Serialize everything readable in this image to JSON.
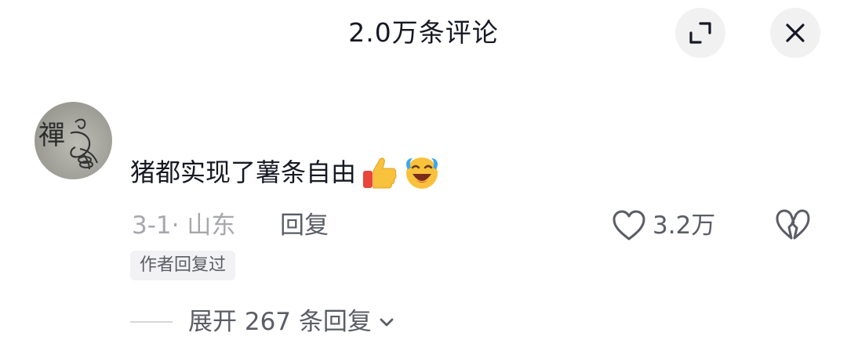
{
  "header": {
    "title": "2.0万条评论"
  },
  "comment": {
    "avatar_seal": "禪",
    "text": "猪都实现了薯条自由",
    "emojis": [
      "thumbs-up-emoji",
      "laughing-crying-emoji"
    ],
    "meta": "3-1· 山东",
    "reply_label": "回复",
    "like_count": "3.2万",
    "author_tag": "作者回复过",
    "expand_replies": "展开 267 条回复"
  },
  "icons": {
    "expand": "expand-icon",
    "close": "close-icon",
    "like": "heart-icon",
    "dislike": "broken-heart-icon",
    "chevron": "chevron-down-icon"
  },
  "colors": {
    "text_primary": "#161823",
    "text_secondary": "#5b5d66",
    "text_muted": "#a6a8ad",
    "button_bg": "#f1f1f2"
  }
}
